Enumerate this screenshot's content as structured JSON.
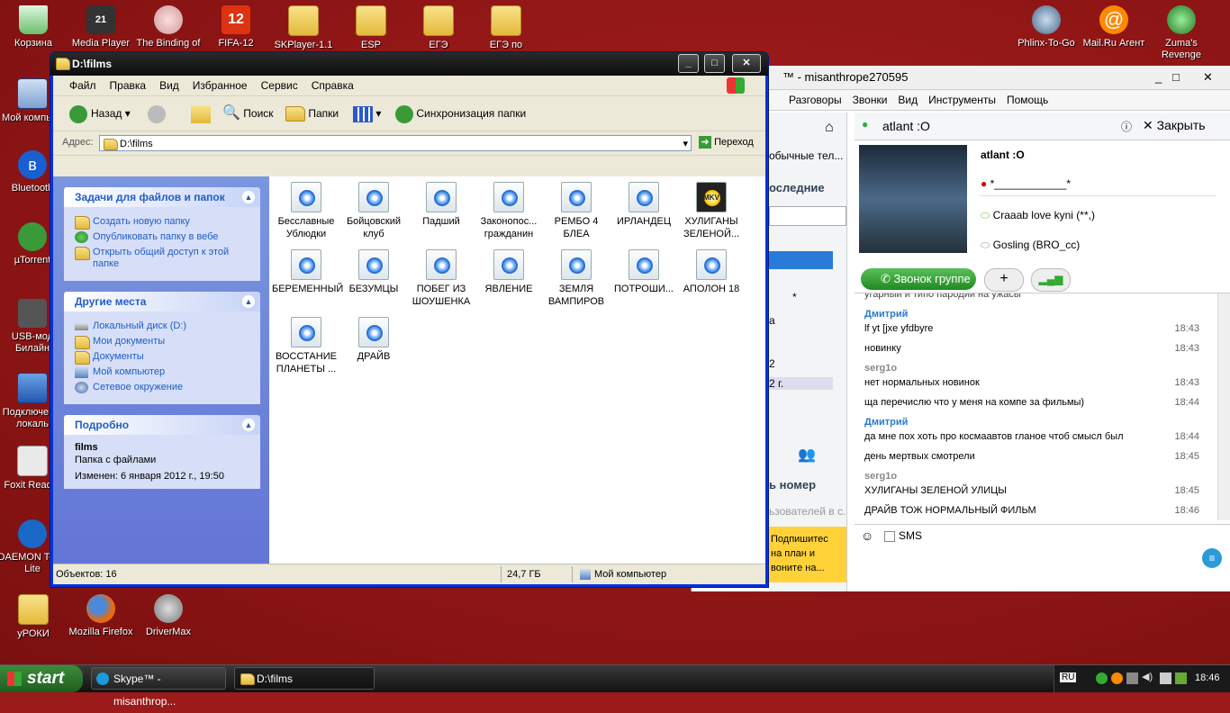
{
  "desktop": {
    "icons_top": [
      "Корзина",
      "Media Player",
      "The Binding of",
      "FIFA-12",
      "SKPlayer-1.1",
      "ESP",
      "ЕГЭ",
      "ЕГЭ по"
    ],
    "icons_top_badge": "21",
    "fifa_badge": "12",
    "icons_right": [
      "Phlinx-To-Go",
      "Mail.Ru Агент",
      "Zuma's Revenge"
    ],
    "icons_left": [
      "Мой компьют",
      "Bluetooth",
      "µTorrent",
      "USB-мод Билайн",
      "Подключе по локаль",
      "Foxit Reader",
      "DAEMON Tools Lite"
    ],
    "icons_bottom": [
      "уРОКИ",
      "Mozilla Firefox",
      "DriverMax"
    ]
  },
  "explorer": {
    "title": "D:\\films",
    "menu": [
      "Файл",
      "Правка",
      "Вид",
      "Избранное",
      "Сервис",
      "Справка"
    ],
    "toolbar": {
      "back": "Назад",
      "search": "Поиск",
      "folders": "Папки",
      "sync": "Синхронизация папки"
    },
    "address_label": "Адрес:",
    "address_value": "D:\\films",
    "go_label": "Переход",
    "tasks_header": "Задачи для файлов и папок",
    "tasks": [
      "Создать новую папку",
      "Опубликовать папку в вебе",
      "Открыть общий доступ к этой папке"
    ],
    "places_header": "Другие места",
    "places": [
      "Локальный диск (D:)",
      "Мои документы",
      "Документы",
      "Мой компьютер",
      "Сетевое окружение"
    ],
    "details_header": "Подробно",
    "details_name": "films",
    "details_type": "Папка с файлами",
    "details_modified": "Изменен: 6 января 2012 г., 19:50",
    "files": [
      [
        "Бесславные",
        "Ублюдки"
      ],
      [
        "Бойцовский",
        "клуб"
      ],
      [
        "Падший",
        ""
      ],
      [
        "Законопос...",
        "гражданин"
      ],
      [
        "РЕМБО 4",
        "БЛЕА"
      ],
      [
        "ИРЛАНДЕЦ",
        ""
      ],
      [
        "ХУЛИГАНЫ",
        "ЗЕЛЕНОЙ..."
      ],
      [
        "БЕРЕМЕННЫЙ",
        ""
      ],
      [
        "БЕЗУМЦЫ",
        ""
      ],
      [
        "ПОБЕГ ИЗ",
        "ШОУШЕНКА"
      ],
      [
        "ЯВЛЕНИЕ",
        ""
      ],
      [
        "ЗЕМЛЯ",
        "ВАМПИРОВ"
      ],
      [
        "ПОТРОШИ...",
        ""
      ],
      [
        "АПОЛОН 18",
        ""
      ],
      [
        "ВОССТАНИЕ",
        "ПЛАНЕТЫ ..."
      ],
      [
        "ДРАЙВ",
        ""
      ]
    ],
    "mkv_badge": "MKV",
    "status_count": "Объектов: 16",
    "status_size": "24,7 ГБ",
    "status_location": "Мой компьютер"
  },
  "skype": {
    "title": "™ - misanthrope270595",
    "menu": [
      "Разговоры",
      "Звонки",
      "Вид",
      "Инструменты",
      "Помощь"
    ],
    "left_fragments": [
      "обычные тел...",
      "оследние",
      "*",
      "а",
      "2",
      "2 г.",
      "ь номер",
      "ьзователей в с...",
      "Подпишитес",
      "на план и",
      "вонитe на..."
    ],
    "contact_title": "atlant :O",
    "close_label": "Закрыть",
    "profile_name": "atlant :O",
    "mood_line": "*____________*",
    "status1": "Craaab love kyni (**,)",
    "status2": "Gosling (BRO_cc)",
    "call_group": "Звонок группе",
    "cut_top": "угарный и типо пародии на ужасы",
    "messages": [
      {
        "kind": "name",
        "text": "Дмитрий"
      },
      {
        "kind": "msg",
        "text": "lf yt [jxe yfdbyre",
        "time": "18:43"
      },
      {
        "kind": "msg",
        "text": "новинку",
        "time": "18:43"
      },
      {
        "kind": "name2",
        "text": "serg1o"
      },
      {
        "kind": "msg",
        "text": "нет нормальных новинок",
        "time": "18:43"
      },
      {
        "kind": "msg",
        "text": "ща перечислю что у меня на компе за фильмы)",
        "time": "18:44"
      },
      {
        "kind": "name",
        "text": "Дмитрий"
      },
      {
        "kind": "msg",
        "text": "да мне пох хоть про космаавтов гланое чтоб смысл был",
        "time": "18:44"
      },
      {
        "kind": "msg",
        "text": "день мертвых смотрели",
        "time": "18:45"
      },
      {
        "kind": "name2",
        "text": "serg1o"
      },
      {
        "kind": "msg",
        "text": "ХУЛИГАНЫ ЗЕЛЕНОЙ УЛИЦЫ",
        "time": "18:45"
      },
      {
        "kind": "msg",
        "text": "ДРАЙВ ТОЖ НОРМАЛЬНЫЙ ФИЛЬМ",
        "time": "18:46"
      }
    ],
    "sms_label": "SMS"
  },
  "taskbar": {
    "start": "start",
    "items": [
      "Skype™ - misanthrop...",
      "D:\\films"
    ],
    "lang": "RU",
    "clock": "18:46"
  }
}
